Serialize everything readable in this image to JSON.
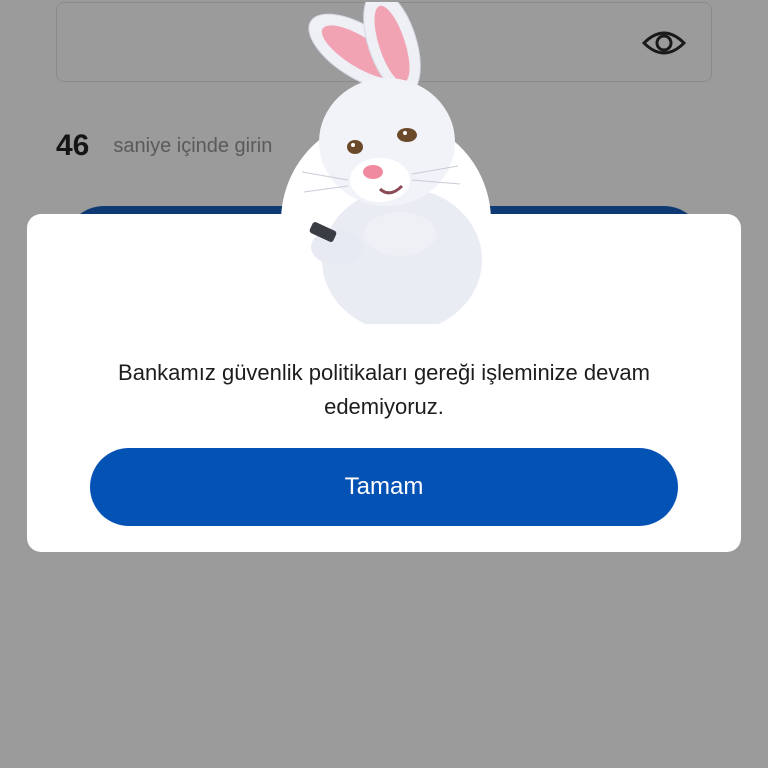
{
  "background": {
    "password_field": {
      "icon": "eye-icon"
    },
    "timer": {
      "seconds": "46",
      "text": "saniye içinde girin"
    },
    "primary_button": {
      "color": "#0d3a74"
    }
  },
  "dialog": {
    "mascot": "white-rabbit-illustration",
    "message": "Bankamız güvenlik politikaları gereği işleminize devam edemiyoruz.",
    "ok_button_label": "Tamam",
    "accent_color": "#0552b5"
  }
}
